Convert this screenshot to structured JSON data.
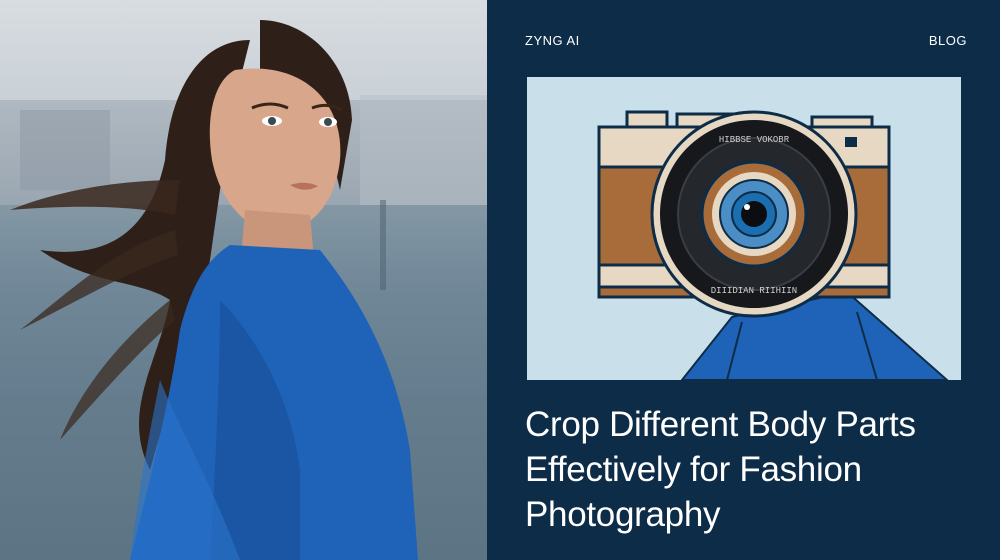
{
  "header": {
    "brand": "ZYNG AI",
    "nav_link": "BLOG"
  },
  "article": {
    "title": "Crop Different Body Parts Effectively for Fashion Photography"
  },
  "illustration": {
    "icon": "camera-icon",
    "lens_text_top": "HIBBSE VOKOBR",
    "lens_text_bottom": "DIIIDIAN RIIHIIN"
  },
  "colors": {
    "panel_background": "#0d2c47",
    "illustration_background": "#c9e0ea",
    "accent_blue": "#1f63b8",
    "camera_brown": "#a86b3a",
    "camera_beige": "#e6d8c2"
  }
}
